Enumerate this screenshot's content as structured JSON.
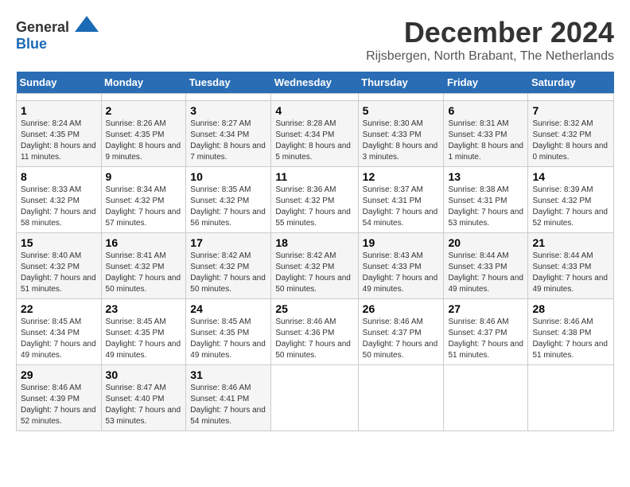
{
  "header": {
    "logo_general": "General",
    "logo_blue": "Blue",
    "month_title": "December 2024",
    "location": "Rijsbergen, North Brabant, The Netherlands"
  },
  "calendar": {
    "days_of_week": [
      "Sunday",
      "Monday",
      "Tuesday",
      "Wednesday",
      "Thursday",
      "Friday",
      "Saturday"
    ],
    "weeks": [
      [
        {
          "day": "",
          "empty": true
        },
        {
          "day": "",
          "empty": true
        },
        {
          "day": "",
          "empty": true
        },
        {
          "day": "",
          "empty": true
        },
        {
          "day": "",
          "empty": true
        },
        {
          "day": "",
          "empty": true
        },
        {
          "day": "",
          "empty": true
        }
      ],
      [
        {
          "day": "1",
          "sunrise": "8:24 AM",
          "sunset": "4:35 PM",
          "daylight": "8 hours and 11 minutes."
        },
        {
          "day": "2",
          "sunrise": "8:26 AM",
          "sunset": "4:35 PM",
          "daylight": "8 hours and 9 minutes."
        },
        {
          "day": "3",
          "sunrise": "8:27 AM",
          "sunset": "4:34 PM",
          "daylight": "8 hours and 7 minutes."
        },
        {
          "day": "4",
          "sunrise": "8:28 AM",
          "sunset": "4:34 PM",
          "daylight": "8 hours and 5 minutes."
        },
        {
          "day": "5",
          "sunrise": "8:30 AM",
          "sunset": "4:33 PM",
          "daylight": "8 hours and 3 minutes."
        },
        {
          "day": "6",
          "sunrise": "8:31 AM",
          "sunset": "4:33 PM",
          "daylight": "8 hours and 1 minute."
        },
        {
          "day": "7",
          "sunrise": "8:32 AM",
          "sunset": "4:32 PM",
          "daylight": "8 hours and 0 minutes."
        }
      ],
      [
        {
          "day": "8",
          "sunrise": "8:33 AM",
          "sunset": "4:32 PM",
          "daylight": "7 hours and 58 minutes."
        },
        {
          "day": "9",
          "sunrise": "8:34 AM",
          "sunset": "4:32 PM",
          "daylight": "7 hours and 57 minutes."
        },
        {
          "day": "10",
          "sunrise": "8:35 AM",
          "sunset": "4:32 PM",
          "daylight": "7 hours and 56 minutes."
        },
        {
          "day": "11",
          "sunrise": "8:36 AM",
          "sunset": "4:32 PM",
          "daylight": "7 hours and 55 minutes."
        },
        {
          "day": "12",
          "sunrise": "8:37 AM",
          "sunset": "4:31 PM",
          "daylight": "7 hours and 54 minutes."
        },
        {
          "day": "13",
          "sunrise": "8:38 AM",
          "sunset": "4:31 PM",
          "daylight": "7 hours and 53 minutes."
        },
        {
          "day": "14",
          "sunrise": "8:39 AM",
          "sunset": "4:32 PM",
          "daylight": "7 hours and 52 minutes."
        }
      ],
      [
        {
          "day": "15",
          "sunrise": "8:40 AM",
          "sunset": "4:32 PM",
          "daylight": "7 hours and 51 minutes."
        },
        {
          "day": "16",
          "sunrise": "8:41 AM",
          "sunset": "4:32 PM",
          "daylight": "7 hours and 50 minutes."
        },
        {
          "day": "17",
          "sunrise": "8:42 AM",
          "sunset": "4:32 PM",
          "daylight": "7 hours and 50 minutes."
        },
        {
          "day": "18",
          "sunrise": "8:42 AM",
          "sunset": "4:32 PM",
          "daylight": "7 hours and 50 minutes."
        },
        {
          "day": "19",
          "sunrise": "8:43 AM",
          "sunset": "4:33 PM",
          "daylight": "7 hours and 49 minutes."
        },
        {
          "day": "20",
          "sunrise": "8:44 AM",
          "sunset": "4:33 PM",
          "daylight": "7 hours and 49 minutes."
        },
        {
          "day": "21",
          "sunrise": "8:44 AM",
          "sunset": "4:33 PM",
          "daylight": "7 hours and 49 minutes."
        }
      ],
      [
        {
          "day": "22",
          "sunrise": "8:45 AM",
          "sunset": "4:34 PM",
          "daylight": "7 hours and 49 minutes."
        },
        {
          "day": "23",
          "sunrise": "8:45 AM",
          "sunset": "4:35 PM",
          "daylight": "7 hours and 49 minutes."
        },
        {
          "day": "24",
          "sunrise": "8:45 AM",
          "sunset": "4:35 PM",
          "daylight": "7 hours and 49 minutes."
        },
        {
          "day": "25",
          "sunrise": "8:46 AM",
          "sunset": "4:36 PM",
          "daylight": "7 hours and 50 minutes."
        },
        {
          "day": "26",
          "sunrise": "8:46 AM",
          "sunset": "4:37 PM",
          "daylight": "7 hours and 50 minutes."
        },
        {
          "day": "27",
          "sunrise": "8:46 AM",
          "sunset": "4:37 PM",
          "daylight": "7 hours and 51 minutes."
        },
        {
          "day": "28",
          "sunrise": "8:46 AM",
          "sunset": "4:38 PM",
          "daylight": "7 hours and 51 minutes."
        }
      ],
      [
        {
          "day": "29",
          "sunrise": "8:46 AM",
          "sunset": "4:39 PM",
          "daylight": "7 hours and 52 minutes."
        },
        {
          "day": "30",
          "sunrise": "8:47 AM",
          "sunset": "4:40 PM",
          "daylight": "7 hours and 53 minutes."
        },
        {
          "day": "31",
          "sunrise": "8:46 AM",
          "sunset": "4:41 PM",
          "daylight": "7 hours and 54 minutes."
        },
        {
          "day": "",
          "empty": true
        },
        {
          "day": "",
          "empty": true
        },
        {
          "day": "",
          "empty": true
        },
        {
          "day": "",
          "empty": true
        }
      ]
    ],
    "labels": {
      "sunrise": "Sunrise:",
      "sunset": "Sunset:",
      "daylight": "Daylight:"
    }
  }
}
